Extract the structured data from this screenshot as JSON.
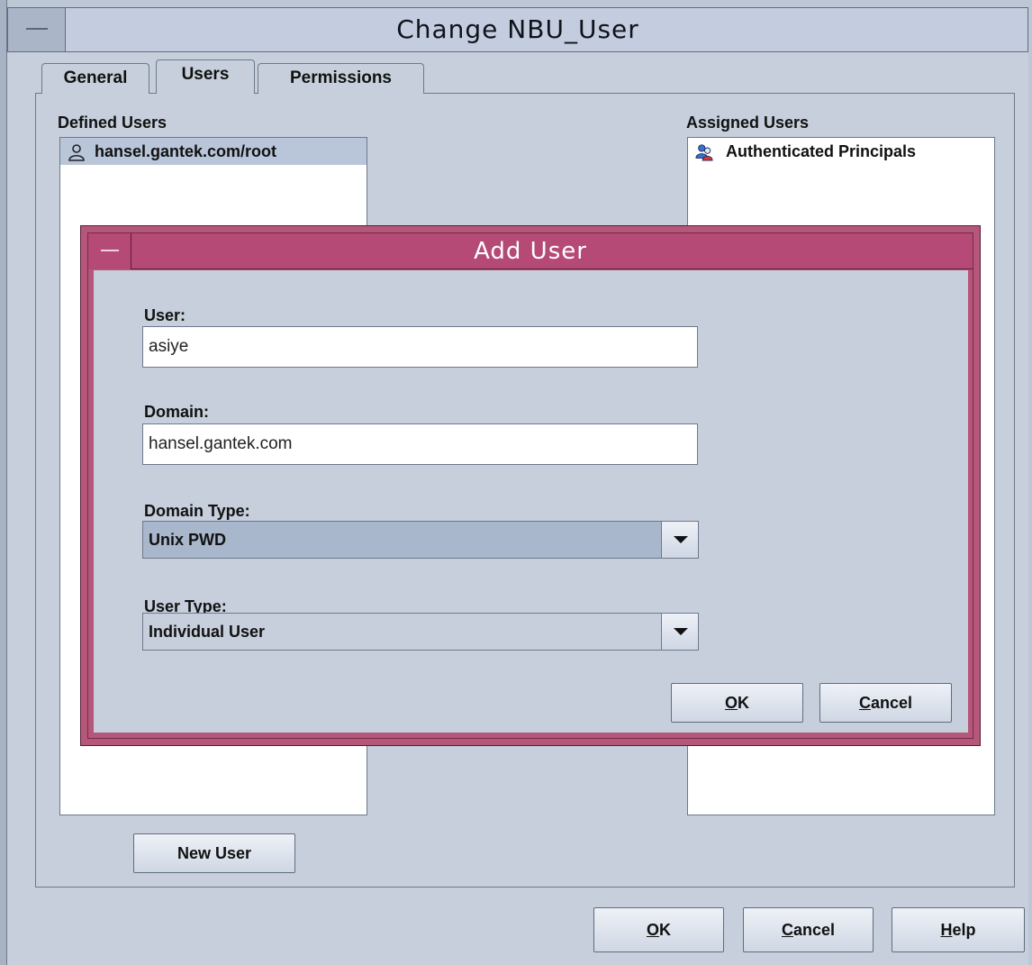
{
  "window": {
    "title": "Change NBU_User",
    "tabs": [
      {
        "label": "General"
      },
      {
        "label": "Users",
        "selected": true
      },
      {
        "label": "Permissions"
      }
    ]
  },
  "users_tab": {
    "defined_users_label": "Defined Users",
    "defined_users": [
      {
        "label": "hansel.gantek.com/root",
        "icon": "user-icon",
        "selected": true
      }
    ],
    "assigned_users_label": "Assigned Users",
    "assigned_users": [
      {
        "label": "Authenticated Principals",
        "icon": "group-icon"
      }
    ],
    "new_user_button": "New User"
  },
  "footer": {
    "ok_mnemonic": "O",
    "ok_rest": "K",
    "cancel_mnemonic": "C",
    "cancel_rest": "ancel",
    "help_mnemonic": "H",
    "help_rest": "elp"
  },
  "dialog": {
    "title": "Add User",
    "user_label": "User:",
    "user_value": "asiye",
    "domain_label": "Domain:",
    "domain_value": "hansel.gantek.com",
    "domain_type_label": "Domain Type:",
    "domain_type_value": "Unix PWD",
    "user_type_label": "User Type:",
    "user_type_value": "Individual User",
    "ok_mnemonic": "O",
    "ok_rest": "K",
    "cancel_mnemonic": "C",
    "cancel_rest": "ancel"
  },
  "colors": {
    "dialog_frame": "#b4577a",
    "selection": "#b9c5d9",
    "panel": "#c6cfdb"
  }
}
